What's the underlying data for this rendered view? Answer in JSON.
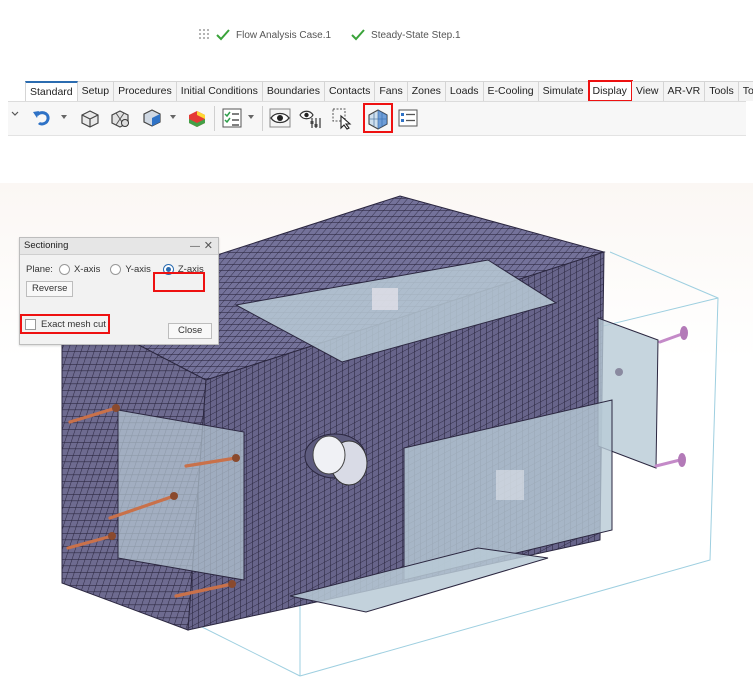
{
  "status_bar": {
    "items": [
      {
        "label": "Flow Analysis Case.1",
        "icon": "green-check-icon"
      },
      {
        "label": "Steady-State Step.1",
        "icon": "green-check-icon"
      }
    ]
  },
  "ribbon": {
    "tabs": [
      {
        "label": "Standard",
        "state": "active"
      },
      {
        "label": "Setup"
      },
      {
        "label": "Procedures"
      },
      {
        "label": "Initial Conditions"
      },
      {
        "label": "Boundaries"
      },
      {
        "label": "Contacts"
      },
      {
        "label": "Fans"
      },
      {
        "label": "Zones"
      },
      {
        "label": "Loads"
      },
      {
        "label": "E-Cooling"
      },
      {
        "label": "Simulate"
      },
      {
        "label": "Display",
        "state": "highlighted"
      },
      {
        "label": "View"
      },
      {
        "label": "AR-VR"
      },
      {
        "label": "Tools"
      },
      {
        "label": "Touch"
      }
    ],
    "toolbar_icons": [
      "undo-icon",
      "part-icon",
      "mesh-tool-icon",
      "shaded-body-icon",
      "color-contour-icon",
      "checklist-icon",
      "eye-visibility-icon",
      "display-settings-icon",
      "select-cursor-icon",
      "sectioning-icon",
      "list-settings-icon"
    ],
    "highlighted_tool": "sectioning-icon"
  },
  "dialog": {
    "title": "Sectioning",
    "plane_label": "Plane:",
    "options": [
      "X-axis",
      "Y-axis",
      "Z-axis"
    ],
    "selected": "Z-axis",
    "reverse_label": "Reverse",
    "exact_mesh_cut_label": "Exact mesh cut",
    "exact_mesh_cut_checked": false,
    "close_label": "Close"
  },
  "colors": {
    "highlight": "#e11111",
    "mesh_fill": "#6e6b90",
    "mesh_line": "#2b2740",
    "section_plane": "#b8cad6",
    "pipe": "#c9714a",
    "check_green": "#3aa33a"
  }
}
